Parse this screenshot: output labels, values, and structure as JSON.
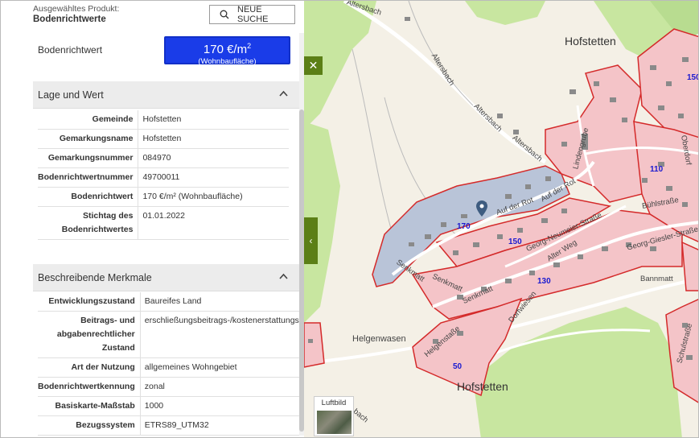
{
  "product": {
    "label": "Ausgewähltes Produkt:",
    "name": "Bodenrichtwerte",
    "search_button": "NEUE SUCHE"
  },
  "summary": {
    "label": "Bodenrichtwert",
    "value": "170 €/m",
    "value_sup": "2",
    "usage": "(Wohnbaufläche)"
  },
  "sections": {
    "lage": {
      "title": "Lage und Wert",
      "rows": [
        {
          "key": "Gemeinde",
          "value": "Hofstetten"
        },
        {
          "key": "Gemarkungsname",
          "value": "Hofstetten"
        },
        {
          "key": "Gemarkungsnummer",
          "value": "084970"
        },
        {
          "key": "Bodenrichtwertnummer",
          "value": "49700011"
        },
        {
          "key": "Bodenrichtwert",
          "value": "170 €/m² (Wohnbaufläche)"
        },
        {
          "key": "Stichtag des Bodenrichtwertes",
          "value": "01.01.2022"
        }
      ]
    },
    "merkmale": {
      "title": "Beschreibende Merkmale",
      "rows": [
        {
          "key": "Entwicklungszustand",
          "value": "Baureifes Land"
        },
        {
          "key": "Beitrags- und abgabenrechtlicher Zustand",
          "value": "erschließungsbeitrags-/kostenerstattungsbeitragsfrei"
        },
        {
          "key": "Art der Nutzung",
          "value": "allgemeines Wohngebiet"
        },
        {
          "key": "Bodenrichtwertkennung",
          "value": "zonal"
        },
        {
          "key": "Basiskarte-Maßstab",
          "value": "1000"
        },
        {
          "key": "Bezugssystem",
          "value": "ETRS89_UTM32"
        }
      ]
    }
  },
  "map": {
    "places": [
      "Hofstetten",
      "Hofstetten",
      "Helgenwasen"
    ],
    "streets": [
      "Altersbach",
      "Altersbach",
      "Altersbach",
      "Altersbach",
      "Lindengrube",
      "Auf der Rot",
      "Auf der Rot",
      "Georg-Neumeier-Straße",
      "Senkmatt",
      "Senkmatt",
      "Senkmatt",
      "Alter Weg",
      "Georg-Giesler-Straße",
      "Bühlstraße",
      "Dorfwiesen",
      "Bannmatt",
      "Helgenstaße",
      "Schulstraße",
      "Oberdorf",
      "bach"
    ],
    "brw_numbers": [
      "170",
      "150",
      "130",
      "110",
      "50",
      "150"
    ],
    "luftbild_label": "Luftbild",
    "colors": {
      "zone_fill": "#f4c4c8",
      "zone_border": "#d42a2a",
      "selected_fill": "#b9c4d8",
      "forest": "#c8e6a0",
      "road": "#ffffff",
      "button": "#5b7f16",
      "brw_box": "#1a3ce8"
    }
  }
}
